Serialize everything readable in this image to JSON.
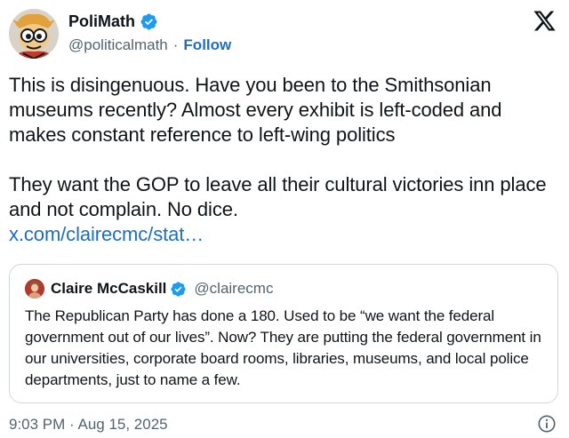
{
  "author": {
    "display_name": "PoliMath",
    "handle": "@politicalmath",
    "separator": "·",
    "follow_label": "Follow",
    "verified": true
  },
  "colors": {
    "verified_blue": "#1d9bf0",
    "link_blue": "#1d6ec0",
    "muted_text": "#536471",
    "border": "#cfd9de"
  },
  "icons": {
    "brand": "x-logo-icon",
    "verified": "verified-badge-icon",
    "info": "info-icon"
  },
  "tweet": {
    "paragraph_1": "This is disingenuous. Have you been to the Smithsonian museums recently? Almost every exhibit is left-coded and makes constant reference to left-wing politics",
    "paragraph_2": "They want the GOP to leave all their cultural victories inn place and not complain. No dice.",
    "link": "x.com/clairecmc/stat…"
  },
  "quoted_tweet": {
    "display_name": "Claire McCaskill",
    "handle": "@clairecmc",
    "verified": true,
    "text": "The Republican Party has done a 180. Used to be “we want the federal government out of our lives”. Now? They are putting the federal government in our universities, corporate board rooms, libraries, museums, and local police departments, just to name a few."
  },
  "timestamp": "9:03 PM · Aug 15, 2025"
}
